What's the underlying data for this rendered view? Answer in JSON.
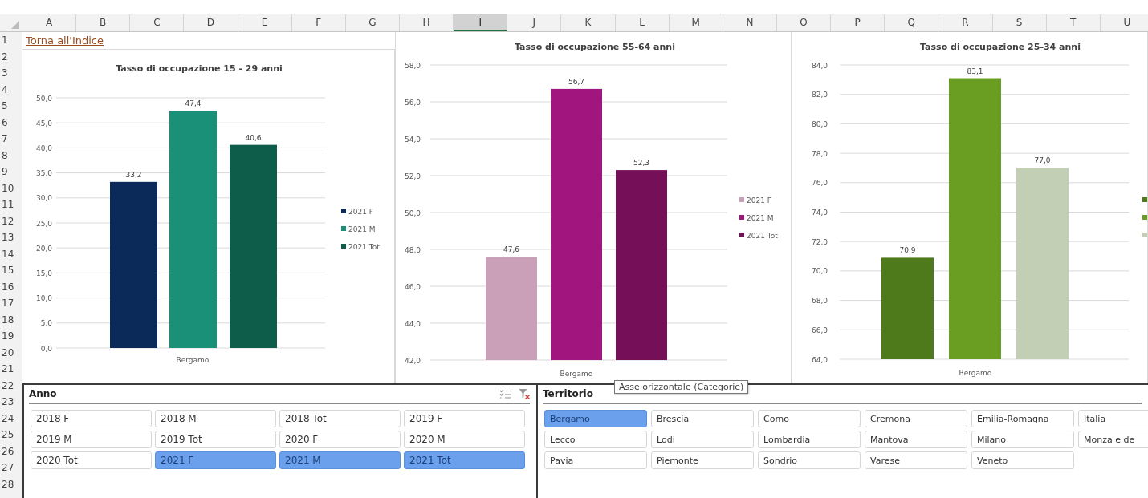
{
  "column_headers": [
    {
      "label": "A",
      "selected": false
    },
    {
      "label": "B",
      "selected": false
    },
    {
      "label": "C",
      "selected": false
    },
    {
      "label": "D",
      "selected": false
    },
    {
      "label": "E",
      "selected": false
    },
    {
      "label": "F",
      "selected": false
    },
    {
      "label": "G",
      "selected": false
    },
    {
      "label": "H",
      "selected": false
    },
    {
      "label": "I",
      "selected": true
    },
    {
      "label": "J",
      "selected": false
    },
    {
      "label": "K",
      "selected": false
    },
    {
      "label": "L",
      "selected": false
    },
    {
      "label": "M",
      "selected": false
    },
    {
      "label": "N",
      "selected": false
    },
    {
      "label": "O",
      "selected": false
    },
    {
      "label": "P",
      "selected": false
    },
    {
      "label": "Q",
      "selected": false
    },
    {
      "label": "R",
      "selected": false
    },
    {
      "label": "S",
      "selected": false
    },
    {
      "label": "T",
      "selected": false
    },
    {
      "label": "U",
      "selected": false
    }
  ],
  "row_headers": [
    "1",
    "2",
    "3",
    "4",
    "5",
    "6",
    "7",
    "8",
    "9",
    "10",
    "11",
    "12",
    "13",
    "14",
    "15",
    "16",
    "17",
    "18",
    "19",
    "20",
    "21",
    "22",
    "23",
    "24",
    "25",
    "26",
    "27",
    "28"
  ],
  "link": "Torna all'Indice",
  "charts": [
    {
      "chart_data": {
        "type": "bar",
        "title": "Tasso di occupazione 15 - 29 anni",
        "categories": [
          "Bergamo"
        ],
        "ylim": [
          0,
          50
        ],
        "yticks": [
          {
            "value": 0,
            "label": "0,0"
          },
          {
            "value": 5,
            "label": "5,0"
          },
          {
            "value": 10,
            "label": "10,0"
          },
          {
            "value": 15,
            "label": "15,0"
          },
          {
            "value": 20,
            "label": "20,0"
          },
          {
            "value": 25,
            "label": "25,0"
          },
          {
            "value": 30,
            "label": "30,0"
          },
          {
            "value": 35,
            "label": "35,0"
          },
          {
            "value": 40,
            "label": "40,0"
          },
          {
            "value": 45,
            "label": "45,0"
          },
          {
            "value": 50,
            "label": "50,0"
          }
        ],
        "grid": true,
        "legend": true,
        "series": [
          {
            "name": "2021 F",
            "color": "#0b2a5a",
            "values": [
              33.2
            ],
            "value_labels": [
              "33,2"
            ]
          },
          {
            "name": "2021 M",
            "color": "#1a9079",
            "values": [
              47.4
            ],
            "value_labels": [
              "47,4"
            ]
          },
          {
            "name": "2021 Tot",
            "color": "#0e5c4a",
            "values": [
              40.6
            ],
            "value_labels": [
              "40,6"
            ]
          }
        ]
      }
    },
    {
      "chart_data": {
        "type": "bar",
        "title": "Tasso di occupazione 55-64 anni",
        "categories": [
          "Bergamo"
        ],
        "ylim": [
          42,
          58
        ],
        "yticks": [
          {
            "value": 42,
            "label": "42,0"
          },
          {
            "value": 44,
            "label": "44,0"
          },
          {
            "value": 46,
            "label": "46,0"
          },
          {
            "value": 48,
            "label": "48,0"
          },
          {
            "value": 50,
            "label": "50,0"
          },
          {
            "value": 52,
            "label": "52,0"
          },
          {
            "value": 54,
            "label": "54,0"
          },
          {
            "value": 56,
            "label": "56,0"
          },
          {
            "value": 58,
            "label": "58,0"
          }
        ],
        "grid": true,
        "legend": true,
        "series": [
          {
            "name": "2021 F",
            "color": "#c9a0b8",
            "values": [
              47.6
            ],
            "value_labels": [
              "47,6"
            ]
          },
          {
            "name": "2021 M",
            "color": "#a0167e",
            "values": [
              56.7
            ],
            "value_labels": [
              "56,7"
            ]
          },
          {
            "name": "2021 Tot",
            "color": "#750f58",
            "values": [
              52.3
            ],
            "value_labels": [
              "52,3"
            ]
          }
        ]
      }
    },
    {
      "chart_data": {
        "type": "bar",
        "title": "Tasso di occupazione 25-34 anni",
        "categories": [
          "Bergamo"
        ],
        "ylim": [
          64,
          84
        ],
        "yticks": [
          {
            "value": 64,
            "label": "64,0"
          },
          {
            "value": 66,
            "label": "66,0"
          },
          {
            "value": 68,
            "label": "68,0"
          },
          {
            "value": 70,
            "label": "70,0"
          },
          {
            "value": 72,
            "label": "72,0"
          },
          {
            "value": 74,
            "label": "74,0"
          },
          {
            "value": 76,
            "label": "76,0"
          },
          {
            "value": 78,
            "label": "78,0"
          },
          {
            "value": 80,
            "label": "80,0"
          },
          {
            "value": 82,
            "label": "82,0"
          },
          {
            "value": 84,
            "label": "84,0"
          }
        ],
        "grid": true,
        "series": [
          {
            "color": "#4f7a1c",
            "values": [
              70.9
            ],
            "value_labels": [
              "70,9"
            ]
          },
          {
            "color": "#6a9e22",
            "values": [
              83.1
            ],
            "value_labels": [
              "83,1"
            ]
          },
          {
            "color": "#c2cfb4",
            "values": [
              77.0
            ],
            "value_labels": [
              "77,0"
            ]
          }
        ]
      }
    }
  ],
  "slicers": [
    {
      "title": "Anno",
      "tools": true,
      "items": [
        {
          "label": "2018 F",
          "selected": false
        },
        {
          "label": "2018 M",
          "selected": false
        },
        {
          "label": "2018 Tot",
          "selected": false
        },
        {
          "label": "2019 F",
          "selected": false
        },
        {
          "label": "2019 M",
          "selected": false
        },
        {
          "label": "2019 Tot",
          "selected": false
        },
        {
          "label": "2020 F",
          "selected": false
        },
        {
          "label": "2020 M",
          "selected": false
        },
        {
          "label": "2020 Tot",
          "selected": false
        },
        {
          "label": "2021 F",
          "selected": true
        },
        {
          "label": "2021 M",
          "selected": true
        },
        {
          "label": "2021 Tot",
          "selected": true
        }
      ]
    },
    {
      "title": "Territorio",
      "tools": false,
      "items": [
        {
          "label": "Bergamo",
          "selected": true
        },
        {
          "label": "Brescia",
          "selected": false
        },
        {
          "label": "Como",
          "selected": false
        },
        {
          "label": "Cremona",
          "selected": false
        },
        {
          "label": "Emilia-Romagna",
          "selected": false
        },
        {
          "label": "Italia",
          "selected": false
        },
        {
          "label": "Lecco",
          "selected": false
        },
        {
          "label": "Lodi",
          "selected": false
        },
        {
          "label": "Lombardia",
          "selected": false
        },
        {
          "label": "Mantova",
          "selected": false
        },
        {
          "label": "Milano",
          "selected": false
        },
        {
          "label": "Monza e de",
          "selected": false
        },
        {
          "label": "Pavia",
          "selected": false
        },
        {
          "label": "Piemonte",
          "selected": false
        },
        {
          "label": "Sondrio",
          "selected": false
        },
        {
          "label": "Varese",
          "selected": false
        },
        {
          "label": "Veneto",
          "selected": false
        }
      ]
    }
  ],
  "tooltip": "Asse orizzontale (Categorie)"
}
